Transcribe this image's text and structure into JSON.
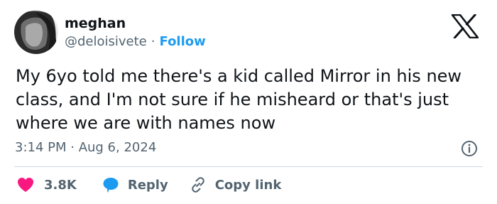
{
  "author": {
    "name": "meghan",
    "handle": "@deloisivete",
    "separator": "·",
    "follow_label": "Follow"
  },
  "tweet": {
    "text": "My 6yo told me there's a kid called Mirror in his new class, and I'm not sure if he misheard or that's just where we are with names now",
    "timestamp": "3:14 PM · Aug 6, 2024"
  },
  "actions": {
    "like_count": "3.8K",
    "reply_label": "Reply",
    "copy_link_label": "Copy link"
  },
  "colors": {
    "like": "#f91880",
    "reply": "#1d9bf0",
    "link": "#1d9bf0",
    "muted": "#536471",
    "text": "#0f1419"
  },
  "icons": {
    "logo": "x-logo",
    "info": "info-icon",
    "like": "heart-icon",
    "reply": "speech-bubble-icon",
    "copy_link": "link-icon"
  }
}
